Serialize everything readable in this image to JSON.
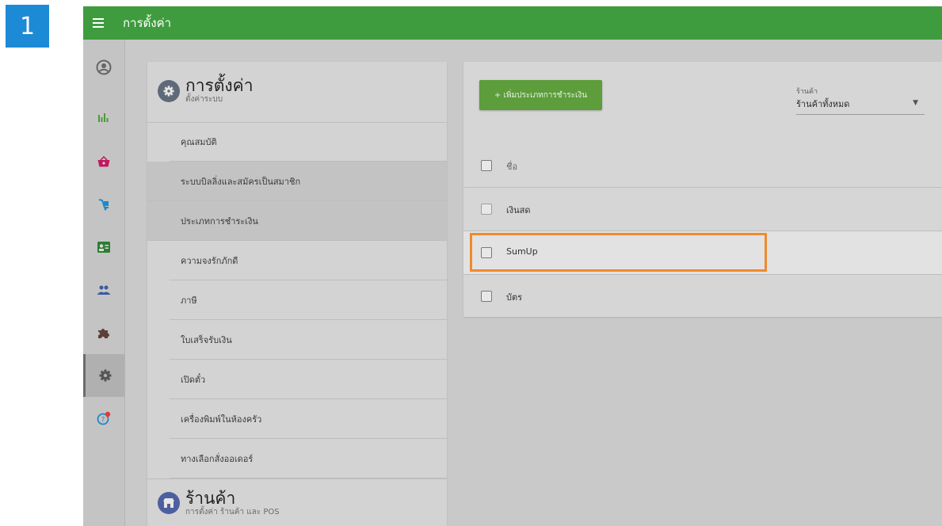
{
  "step_badge": "1",
  "topbar": {
    "title": "การตั้งค่า",
    "menu_icon": "hamburger-icon"
  },
  "sidebar": {
    "items": [
      {
        "name": "account-icon",
        "color": "#666666"
      },
      {
        "name": "reports-icon",
        "color": "#4a9a3a"
      },
      {
        "name": "basket-icon",
        "color": "#c2185b"
      },
      {
        "name": "items-icon",
        "color": "#1e88c8"
      },
      {
        "name": "employees-icon",
        "color": "#2e7d32"
      },
      {
        "name": "customers-icon",
        "color": "#3a5aa0"
      },
      {
        "name": "integrations-icon",
        "color": "#5d4037"
      },
      {
        "name": "settings-icon",
        "color": "#555555",
        "active": true
      },
      {
        "name": "help-icon",
        "color": "#1e88c8"
      }
    ]
  },
  "settings_card": {
    "title": "การตั้งค่า",
    "subtitle": "ตั้งค่าระบบ",
    "items": [
      {
        "label": "คุณสมบัติ"
      },
      {
        "label": "ระบบบิลลิ่งและสมัครเป็นสมาชิก"
      },
      {
        "label": "ประเภทการชำระเงิน"
      },
      {
        "label": "ความจงรักภักดี"
      },
      {
        "label": "ภาษี"
      },
      {
        "label": "ใบเสร็จรับเงิน"
      },
      {
        "label": "เปิดตั๋ว"
      },
      {
        "label": "เครื่องพิมพ์ในห้องครัว"
      },
      {
        "label": "ทางเลือกสั่งออเดอร์"
      }
    ],
    "store_section": {
      "title": "ร้านค้า",
      "subtitle": "การตั้งค่า ร้านค้า และ POS"
    }
  },
  "content": {
    "add_button_label": "+ เพิ่มประเภทการชำระเงิน",
    "store_select": {
      "label": "ร้านค้า",
      "value": "ร้านค้าทั้งหมด"
    },
    "table": {
      "header": "ชื่อ",
      "rows": [
        {
          "name": "เงินสด"
        },
        {
          "name": "SumUp"
        },
        {
          "name": "บัตร"
        }
      ]
    }
  },
  "colors": {
    "topbar": "#3f9c3e",
    "highlight_box": "#f08a2c",
    "step_badge": "#1d8ad6",
    "add_button": "#5d9d3c"
  }
}
